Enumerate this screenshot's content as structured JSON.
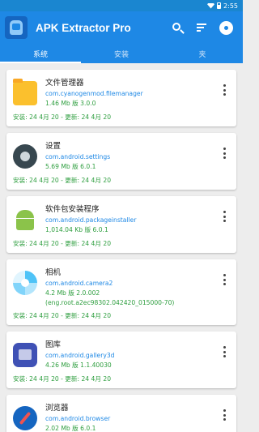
{
  "status_bar": {
    "time": "2:55"
  },
  "app_bar": {
    "title": "APK Extractor Pro",
    "actions": [
      "search-icon",
      "sort-icon",
      "settings-icon"
    ]
  },
  "tabs": [
    {
      "label": "系统",
      "active": true
    },
    {
      "label": "安装",
      "active": false
    },
    {
      "label": "夹",
      "active": false
    }
  ],
  "apps": [
    {
      "name": "文件管理器",
      "package": "com.cyanogenmod.filemanager",
      "version_line": "1.46 Mb 版 3.0.0",
      "version_extra": "",
      "dates": "安装: 24 4月 20 - 更新: 24 4月 20",
      "icon": "folder-icon"
    },
    {
      "name": "设置",
      "package": "com.android.settings",
      "version_line": "5.69 Mb 版 6.0.1",
      "version_extra": "",
      "dates": "安装: 24 4月 20 - 更新: 24 4月 20",
      "icon": "settings-app-icon"
    },
    {
      "name": "软件包安装程序",
      "package": "com.android.packageinstaller",
      "version_line": "1,014.04 Kb 版 6.0.1",
      "version_extra": "",
      "dates": "安装: 24 4月 20 - 更新: 24 4月 20",
      "icon": "android-icon"
    },
    {
      "name": "相机",
      "package": "com.android.camera2",
      "version_line": "4.2 Mb 版 2.0.002",
      "version_extra": "(eng.root.a2ec98302.042420_015000-70)",
      "dates": "安装: 24 4月 20 - 更新: 24 4月 20",
      "icon": "camera-icon"
    },
    {
      "name": "图库",
      "package": "com.android.gallery3d",
      "version_line": "4.26 Mb 版 1.1.40030",
      "version_extra": "",
      "dates": "安装: 24 4月 20 - 更新: 24 4月 20",
      "icon": "gallery-icon"
    },
    {
      "name": "浏览器",
      "package": "com.android.browser",
      "version_line": "2.02 Mb 版 6.0.1",
      "version_extra": "",
      "dates": "",
      "icon": "browser-icon"
    }
  ],
  "colors": {
    "primary": "#1e88e5",
    "status_bar": "#1a86d0",
    "package_text": "#1e88e5",
    "version_text": "#2e9e3f",
    "background": "#ededed"
  }
}
